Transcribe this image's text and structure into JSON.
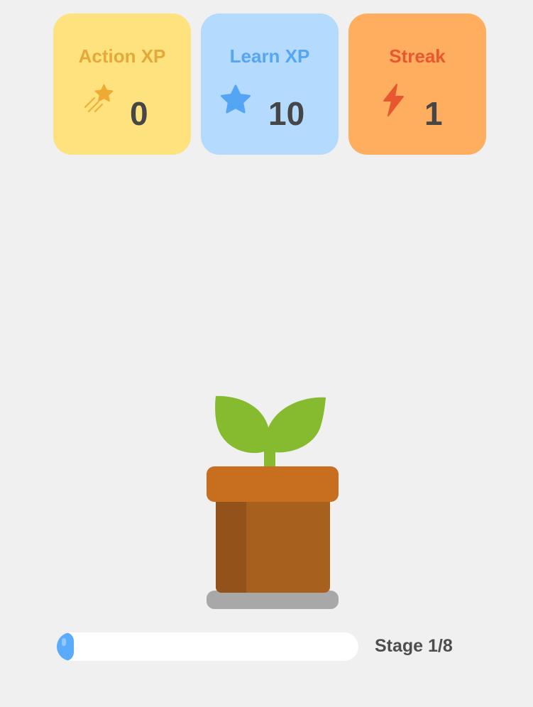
{
  "stats": {
    "action_xp": {
      "label": "Action XP",
      "value": "0",
      "icon": "shooting-star-icon",
      "color": "#e4a939",
      "background": "#fee27d"
    },
    "learn_xp": {
      "label": "Learn XP",
      "value": "10",
      "icon": "star-icon",
      "color": "#54a6f5",
      "background": "#b4dbfd"
    },
    "streak": {
      "label": "Streak",
      "value": "1",
      "icon": "lightning-bolt-icon",
      "color": "#e85830",
      "background": "#ffad5f"
    }
  },
  "plant": {
    "icon": "potted-sprout-icon",
    "leaf_color": "#86bb2f",
    "pot_color": "#c86f1f"
  },
  "progress": {
    "stage_label": "Stage 1/8",
    "current_stage": 1,
    "total_stages": 8,
    "fill_fraction": 0.05,
    "fill_color": "#5aabfb"
  }
}
